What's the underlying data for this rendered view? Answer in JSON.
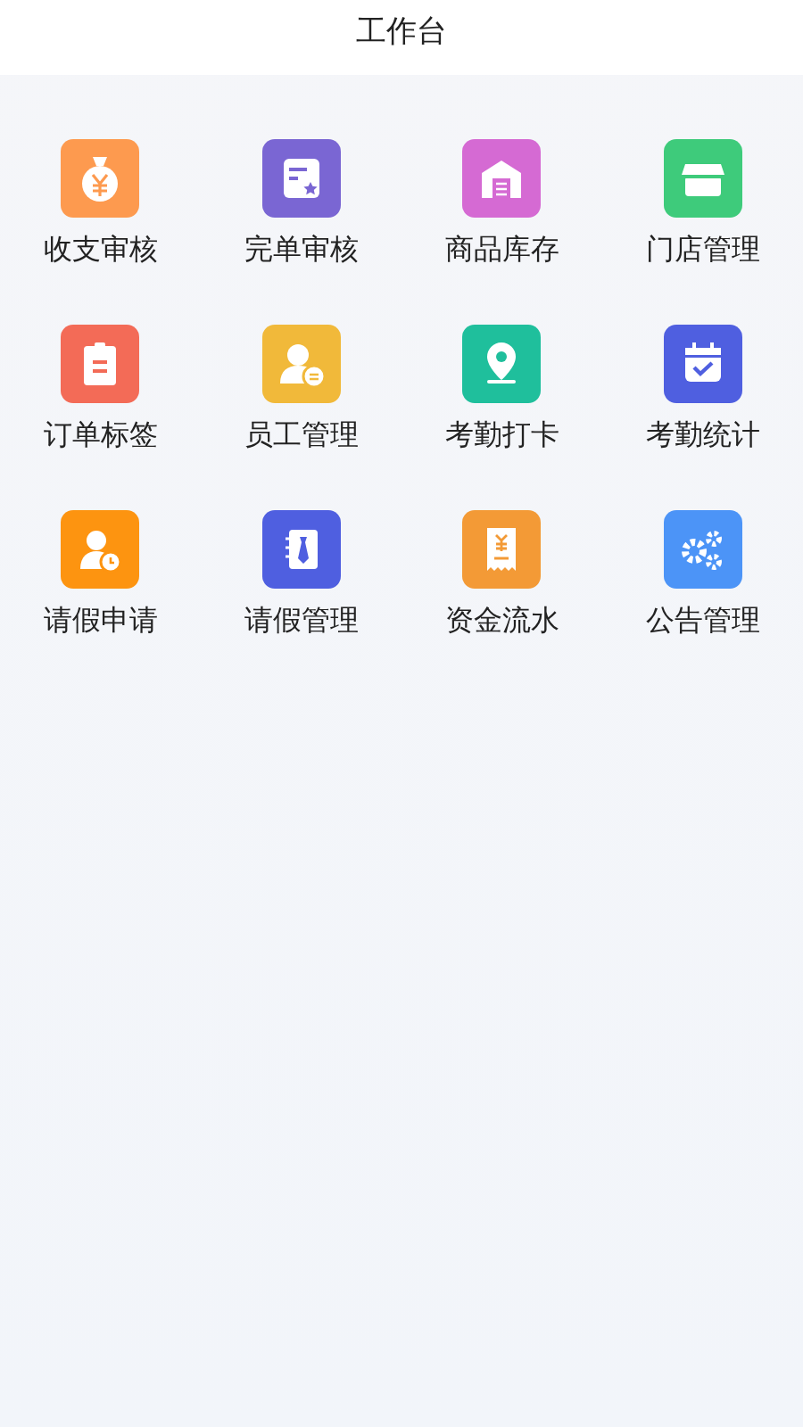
{
  "header": {
    "title": "工作台"
  },
  "tiles": [
    {
      "label": "收支审核",
      "kind": "moneybag",
      "color": "#fd9a4f"
    },
    {
      "label": "完单审核",
      "kind": "card",
      "color": "#7a66d3"
    },
    {
      "label": "商品库存",
      "kind": "warehouse",
      "color": "#d56ad3"
    },
    {
      "label": "门店管理",
      "kind": "store",
      "color": "#3ecb7b"
    },
    {
      "label": "订单标签",
      "kind": "clipboard",
      "color": "#f36b57"
    },
    {
      "label": "员工管理",
      "kind": "staff",
      "color": "#f1b93a"
    },
    {
      "label": "考勤打卡",
      "kind": "pin",
      "color": "#1fbf9c"
    },
    {
      "label": "考勤统计",
      "kind": "calendar",
      "color": "#4f5fe0"
    },
    {
      "label": "请假申请",
      "kind": "personclock",
      "color": "#fd9410"
    },
    {
      "label": "请假管理",
      "kind": "notebook",
      "color": "#4f5fe0"
    },
    {
      "label": "资金流水",
      "kind": "receipt",
      "color": "#f39a36"
    },
    {
      "label": "公告管理",
      "kind": "gears",
      "color": "#4c94f7"
    }
  ]
}
